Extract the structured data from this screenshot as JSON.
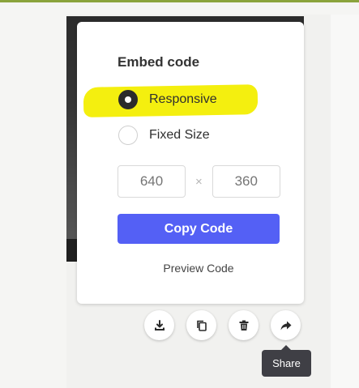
{
  "embed": {
    "title": "Embed code",
    "options": [
      {
        "label": "Responsive",
        "selected": true
      },
      {
        "label": "Fixed Size",
        "selected": false
      }
    ],
    "width_placeholder": "640",
    "height_placeholder": "360",
    "times_symbol": "×",
    "copy_label": "Copy Code",
    "preview_label": "Preview Code",
    "highlight_color": "#f4ef0f",
    "button_color": "#5460f5"
  },
  "actions": {
    "icons": [
      "download-icon",
      "copy-icon",
      "trash-icon",
      "share-icon"
    ],
    "tooltip": "Share"
  }
}
